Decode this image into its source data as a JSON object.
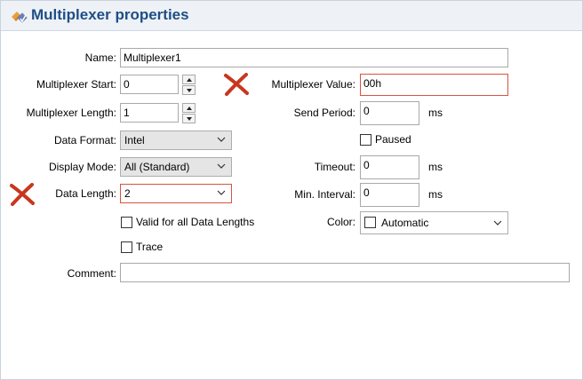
{
  "window": {
    "title": "Multiplexer properties"
  },
  "form": {
    "name": {
      "label": "Name:",
      "value": "Multiplexer1"
    },
    "mux_start": {
      "label": "Multiplexer Start:",
      "value": "0"
    },
    "mux_length": {
      "label": "Multiplexer Length:",
      "value": "1"
    },
    "data_format": {
      "label": "Data Format:",
      "value": "Intel"
    },
    "display_mode": {
      "label": "Display Mode:",
      "value": "All (Standard)"
    },
    "data_length": {
      "label": "Data Length:",
      "value": "2"
    },
    "valid_all": {
      "label": "Valid for all Data Lengths",
      "checked": false
    },
    "trace": {
      "label": "Trace",
      "checked": false
    },
    "comment": {
      "label": "Comment:",
      "value": ""
    },
    "mux_value": {
      "label": "Multiplexer Value:",
      "value": "00h"
    },
    "send_period": {
      "label": "Send Period:",
      "value": "0",
      "unit": "ms"
    },
    "paused": {
      "label": "Paused",
      "checked": false
    },
    "timeout": {
      "label": "Timeout:",
      "value": "0",
      "unit": "ms"
    },
    "min_interval": {
      "label": "Min. Interval:",
      "value": "0",
      "unit": "ms"
    },
    "color": {
      "label": "Color:",
      "value": "Automatic"
    }
  },
  "colors": {
    "title": "#1f4e86",
    "error_border": "#d9533f",
    "error_icon": "#c8361e"
  },
  "icons": {
    "title_icon": "multiplexer-icon",
    "error_icon": "error-x-icon",
    "dropdown": "chevron-down-icon"
  }
}
